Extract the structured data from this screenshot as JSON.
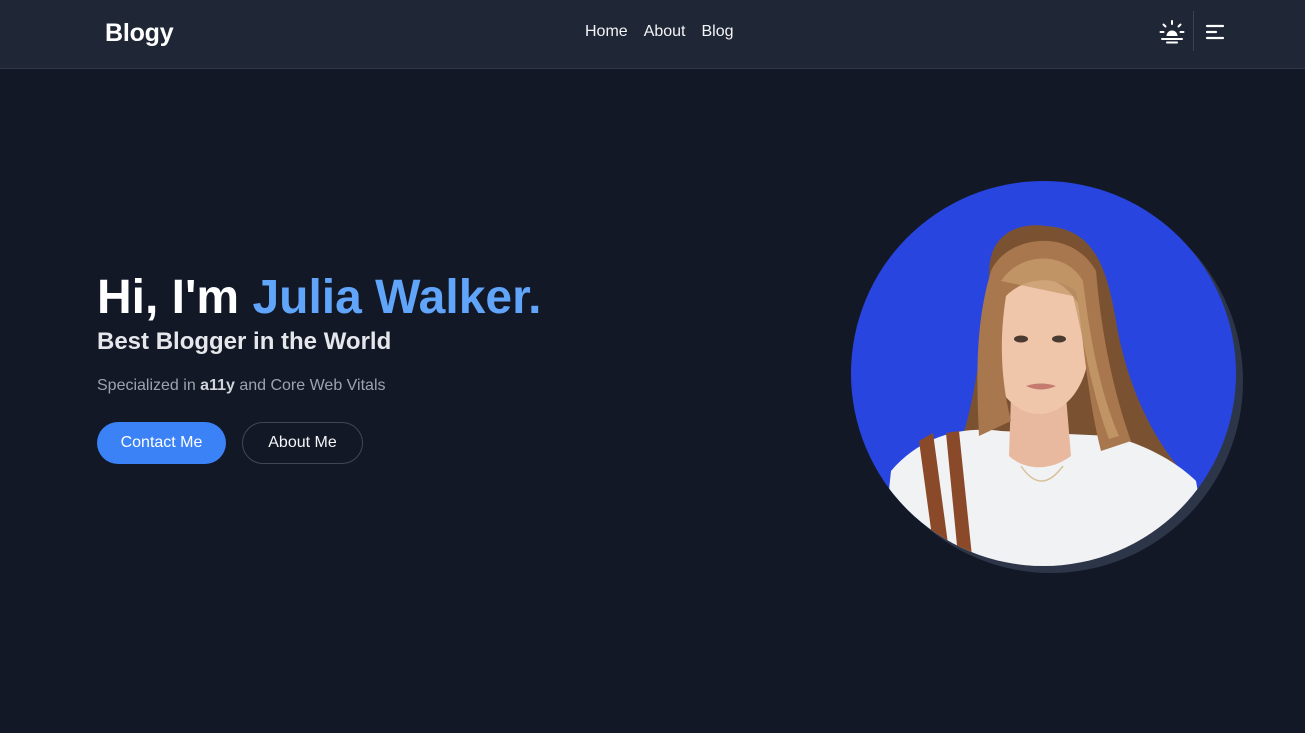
{
  "header": {
    "logo": "Blogy",
    "nav": [
      {
        "label": "Home"
      },
      {
        "label": "About"
      },
      {
        "label": "Blog"
      }
    ],
    "theme_icon": "sun-icon",
    "menu_icon": "menu-icon"
  },
  "hero": {
    "greeting": "Hi, I'm ",
    "name": "Julia Walker.",
    "subtitle": "Best Blogger in the World",
    "tagline_prefix": "Specialized in ",
    "tagline_bold": "a11y",
    "tagline_suffix": " and Core Web Vitals",
    "primary_button": "Contact Me",
    "secondary_button": "About Me",
    "avatar_icon": "portrait-photo"
  },
  "colors": {
    "background": "#131827",
    "navbar": "#1f2736",
    "accent": "#60a5fa",
    "primary_button": "#3b82f6",
    "avatar_bg": "#2945e0"
  }
}
